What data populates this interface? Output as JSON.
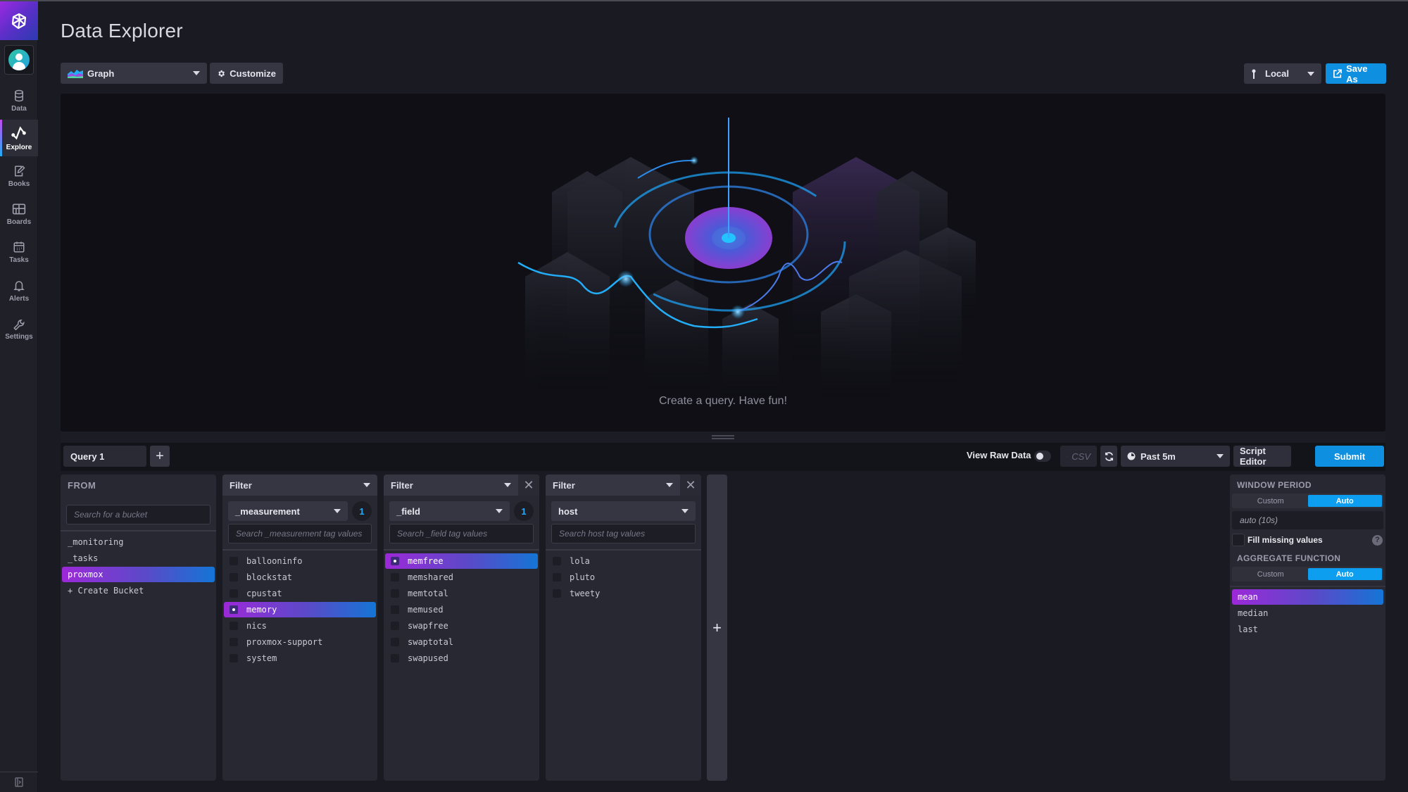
{
  "sidebar": {
    "logo_icon": "influxdb-cube-icon",
    "avatar_icon": "user-avatar-icon",
    "items": [
      {
        "label": "Data",
        "icon": "database-icon"
      },
      {
        "label": "Explore",
        "icon": "graph-line-icon",
        "active": true
      },
      {
        "label": "Books",
        "icon": "notebook-pencil-icon"
      },
      {
        "label": "Boards",
        "icon": "dashboard-grid-icon"
      },
      {
        "label": "Tasks",
        "icon": "calendar-icon"
      },
      {
        "label": "Alerts",
        "icon": "bell-icon"
      },
      {
        "label": "Settings",
        "icon": "wrench-icon"
      }
    ],
    "collapse_icon": "sidebar-collapse-icon"
  },
  "header": {
    "title": "Data Explorer",
    "view_type": "Graph",
    "customize_label": "Customize",
    "location_label": "Local",
    "save_as_label": "Save As"
  },
  "graph": {
    "empty_message": "Create a query. Have fun!"
  },
  "query_bar": {
    "query_tab": "Query 1",
    "add_query_label": "+",
    "view_raw_label": "View Raw Data",
    "view_raw_enabled": false,
    "csv_label": "CSV",
    "time_range": "Past 5m",
    "script_editor_label": "Script Editor",
    "submit_label": "Submit"
  },
  "builder": {
    "from": {
      "title": "FROM",
      "search_placeholder": "Search for a bucket",
      "buckets": [
        "_monitoring",
        "_tasks",
        "proxmox"
      ],
      "selected": "proxmox",
      "create_label": "+ Create Bucket"
    },
    "filters": [
      {
        "title": "Filter",
        "key": "_measurement",
        "count": "1",
        "search_placeholder": "Search _measurement tag values",
        "values": [
          "ballooninfo",
          "blockstat",
          "cpustat",
          "memory",
          "nics",
          "proxmox-support",
          "system"
        ],
        "selected": "memory",
        "closable": false
      },
      {
        "title": "Filter",
        "key": "_field",
        "count": "1",
        "search_placeholder": "Search _field tag values",
        "values": [
          "memfree",
          "memshared",
          "memtotal",
          "memused",
          "swapfree",
          "swaptotal",
          "swapused"
        ],
        "selected": "memfree",
        "closable": true
      },
      {
        "title": "Filter",
        "key": "host",
        "count": "",
        "search_placeholder": "Search host tag values",
        "values": [
          "lola",
          "pluto",
          "tweety"
        ],
        "selected": "",
        "closable": true
      }
    ],
    "add_filter_label": "+"
  },
  "aggregate": {
    "window_period_title": "WINDOW PERIOD",
    "window_mode_options": [
      "Custom",
      "Auto"
    ],
    "window_mode_selected": "Auto",
    "window_value": "auto (10s)",
    "fill_missing_label": "Fill missing values",
    "fill_missing_checked": false,
    "aggregate_function_title": "AGGREGATE FUNCTION",
    "function_mode_options": [
      "Custom",
      "Auto"
    ],
    "function_mode_selected": "Auto",
    "functions": [
      "mean",
      "median",
      "last"
    ],
    "selected_function": "mean"
  },
  "colors": {
    "accent_blue": "#0e8fe0",
    "selection_gradient_start": "#9c29d8",
    "selection_gradient_end": "#1475d6",
    "count_badge": "#22adf6"
  }
}
